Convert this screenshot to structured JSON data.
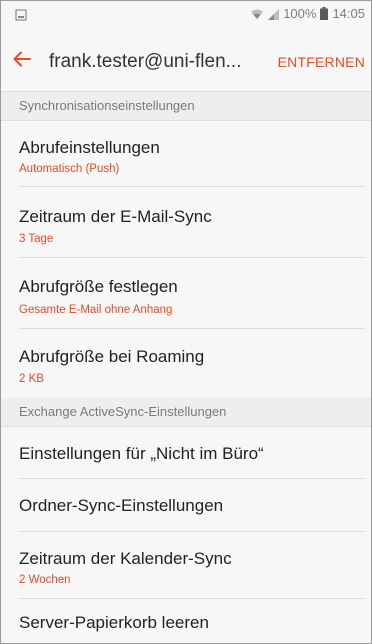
{
  "status_bar": {
    "battery_percent": "100%",
    "time": "14:05",
    "icons": [
      "notification-icon",
      "wifi-icon",
      "signal-icon",
      "battery-icon"
    ]
  },
  "app_bar": {
    "back_icon": "arrow-left-icon",
    "title": "frank.tester@uni-flen...",
    "action_label": "ENTFERNEN"
  },
  "sections": [
    {
      "header": "Synchronisationseinstellungen",
      "items": [
        {
          "title": "Abrufeinstellungen",
          "subtitle": "Automatisch (Push)"
        },
        {
          "title": "Zeitraum der E-Mail-Sync",
          "subtitle": "3 Tage"
        },
        {
          "title": "Abrufgröße festlegen",
          "subtitle": "Gesamte E-Mail ohne Anhang"
        },
        {
          "title": "Abrufgröße bei Roaming",
          "subtitle": "2 KB"
        }
      ]
    },
    {
      "header": "Exchange ActiveSync-Einstellungen",
      "items": [
        {
          "title": "Einstellungen für „Nicht im Büro“"
        },
        {
          "title": "Ordner-Sync-Einstellungen"
        },
        {
          "title": "Zeitraum der Kalender-Sync",
          "subtitle": "2 Wochen"
        },
        {
          "title": "Server-Papierkorb leeren"
        }
      ]
    }
  ],
  "colors": {
    "accent": "#e64a27",
    "background": "#f7f7f7",
    "section_background": "#eeeeee",
    "text_primary": "#222222",
    "text_secondary": "#7a7a7a"
  }
}
